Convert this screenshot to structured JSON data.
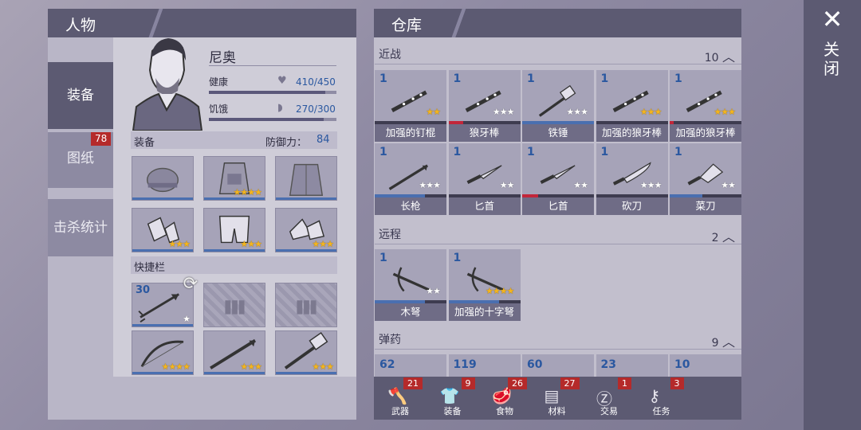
{
  "left": {
    "title": "人物",
    "tabs": [
      {
        "label": "装备",
        "active": true
      },
      {
        "label": "图纸",
        "badge": "78"
      },
      {
        "label": "击杀统计"
      }
    ],
    "character": {
      "name": "尼奥",
      "health_label": "健康",
      "health_value": "410/450",
      "health_fraction": 0.91,
      "hunger_label": "饥饿",
      "hunger_value": "270/300",
      "hunger_fraction": 0.9
    },
    "equipment": {
      "label": "装备",
      "defense_label": "防御力：",
      "defense_value": "84",
      "slots": [
        {
          "icon": "beanie-icon",
          "stars": 0
        },
        {
          "icon": "vest-icon",
          "stars": 4
        },
        {
          "icon": "jacket-icon",
          "stars": 0
        },
        {
          "icon": "gloves-icon",
          "stars": 3
        },
        {
          "icon": "shorts-icon",
          "stars": 3
        },
        {
          "icon": "shoes-icon",
          "stars": 3
        }
      ]
    },
    "quickbar": {
      "label": "快捷栏",
      "slots": [
        {
          "icon": "arrow-icon",
          "count": "30",
          "stars": 1
        },
        {
          "icon": "ammo-slot-icon",
          "empty": true
        },
        {
          "icon": "ammo-slot-icon",
          "empty": true
        },
        {
          "icon": "bow-icon",
          "stars": 4
        },
        {
          "icon": "spear-icon",
          "stars": 3
        },
        {
          "icon": "hammer-icon",
          "stars": 3
        }
      ]
    }
  },
  "right": {
    "title": "仓库",
    "melee": {
      "label": "近战",
      "count": "10",
      "items": [
        {
          "count": "1",
          "name": "加强的钉棍",
          "stars": 2,
          "gold": true,
          "bar": 0.0,
          "bar_color": "blue"
        },
        {
          "count": "1",
          "name": "狼牙棒",
          "stars": 3,
          "gold": false,
          "bar": 0.2,
          "bar_color": "red"
        },
        {
          "count": "1",
          "name": "铁锤",
          "stars": 3,
          "gold": false,
          "bar": 1.0,
          "bar_color": "blue"
        },
        {
          "count": "1",
          "name": "加强的狼牙棒",
          "stars": 3,
          "gold": true,
          "bar": 0.0,
          "bar_color": "blue"
        },
        {
          "count": "1",
          "name": "加强的狼牙棒",
          "stars": 3,
          "gold": true,
          "bar": 0.06,
          "bar_color": "red"
        },
        {
          "count": "1",
          "name": "长枪",
          "stars": 3,
          "gold": false,
          "bar": 0.7,
          "bar_color": "blue"
        },
        {
          "count": "1",
          "name": "匕首",
          "stars": 2,
          "gold": false,
          "bar": 0.0,
          "bar_color": "blue"
        },
        {
          "count": "1",
          "name": "匕首",
          "stars": 2,
          "gold": false,
          "bar": 0.22,
          "bar_color": "red"
        },
        {
          "count": "1",
          "name": "砍刀",
          "stars": 3,
          "gold": false,
          "bar": 0.0,
          "bar_color": "blue"
        },
        {
          "count": "1",
          "name": "菜刀",
          "stars": 2,
          "gold": false,
          "bar": 0.45,
          "bar_color": "blue"
        }
      ]
    },
    "ranged": {
      "label": "远程",
      "count": "2",
      "items": [
        {
          "count": "1",
          "name": "木弩",
          "stars": 2,
          "gold": false,
          "bar": 0.7,
          "bar_color": "blue"
        },
        {
          "count": "1",
          "name": "加强的十字弩",
          "stars": 4,
          "gold": true,
          "bar": 0.7,
          "bar_color": "blue"
        }
      ]
    },
    "ammo": {
      "label": "弹药",
      "count": "9",
      "items": [
        {
          "count": "62"
        },
        {
          "count": "119"
        },
        {
          "count": "60"
        },
        {
          "count": "23"
        },
        {
          "count": "10"
        }
      ]
    },
    "bottom_tabs": [
      {
        "label": "武器",
        "badge": "21",
        "icon": "axe-icon"
      },
      {
        "label": "装备",
        "badge": "9",
        "icon": "shirt-icon"
      },
      {
        "label": "食物",
        "badge": "26",
        "icon": "meat-icon"
      },
      {
        "label": "材料",
        "badge": "27",
        "icon": "planks-icon"
      },
      {
        "label": "交易",
        "badge": "1",
        "icon": "coin-icon"
      },
      {
        "label": "任务",
        "badge": "3",
        "icon": "key-icon"
      }
    ]
  },
  "close": {
    "label": "关闭"
  }
}
